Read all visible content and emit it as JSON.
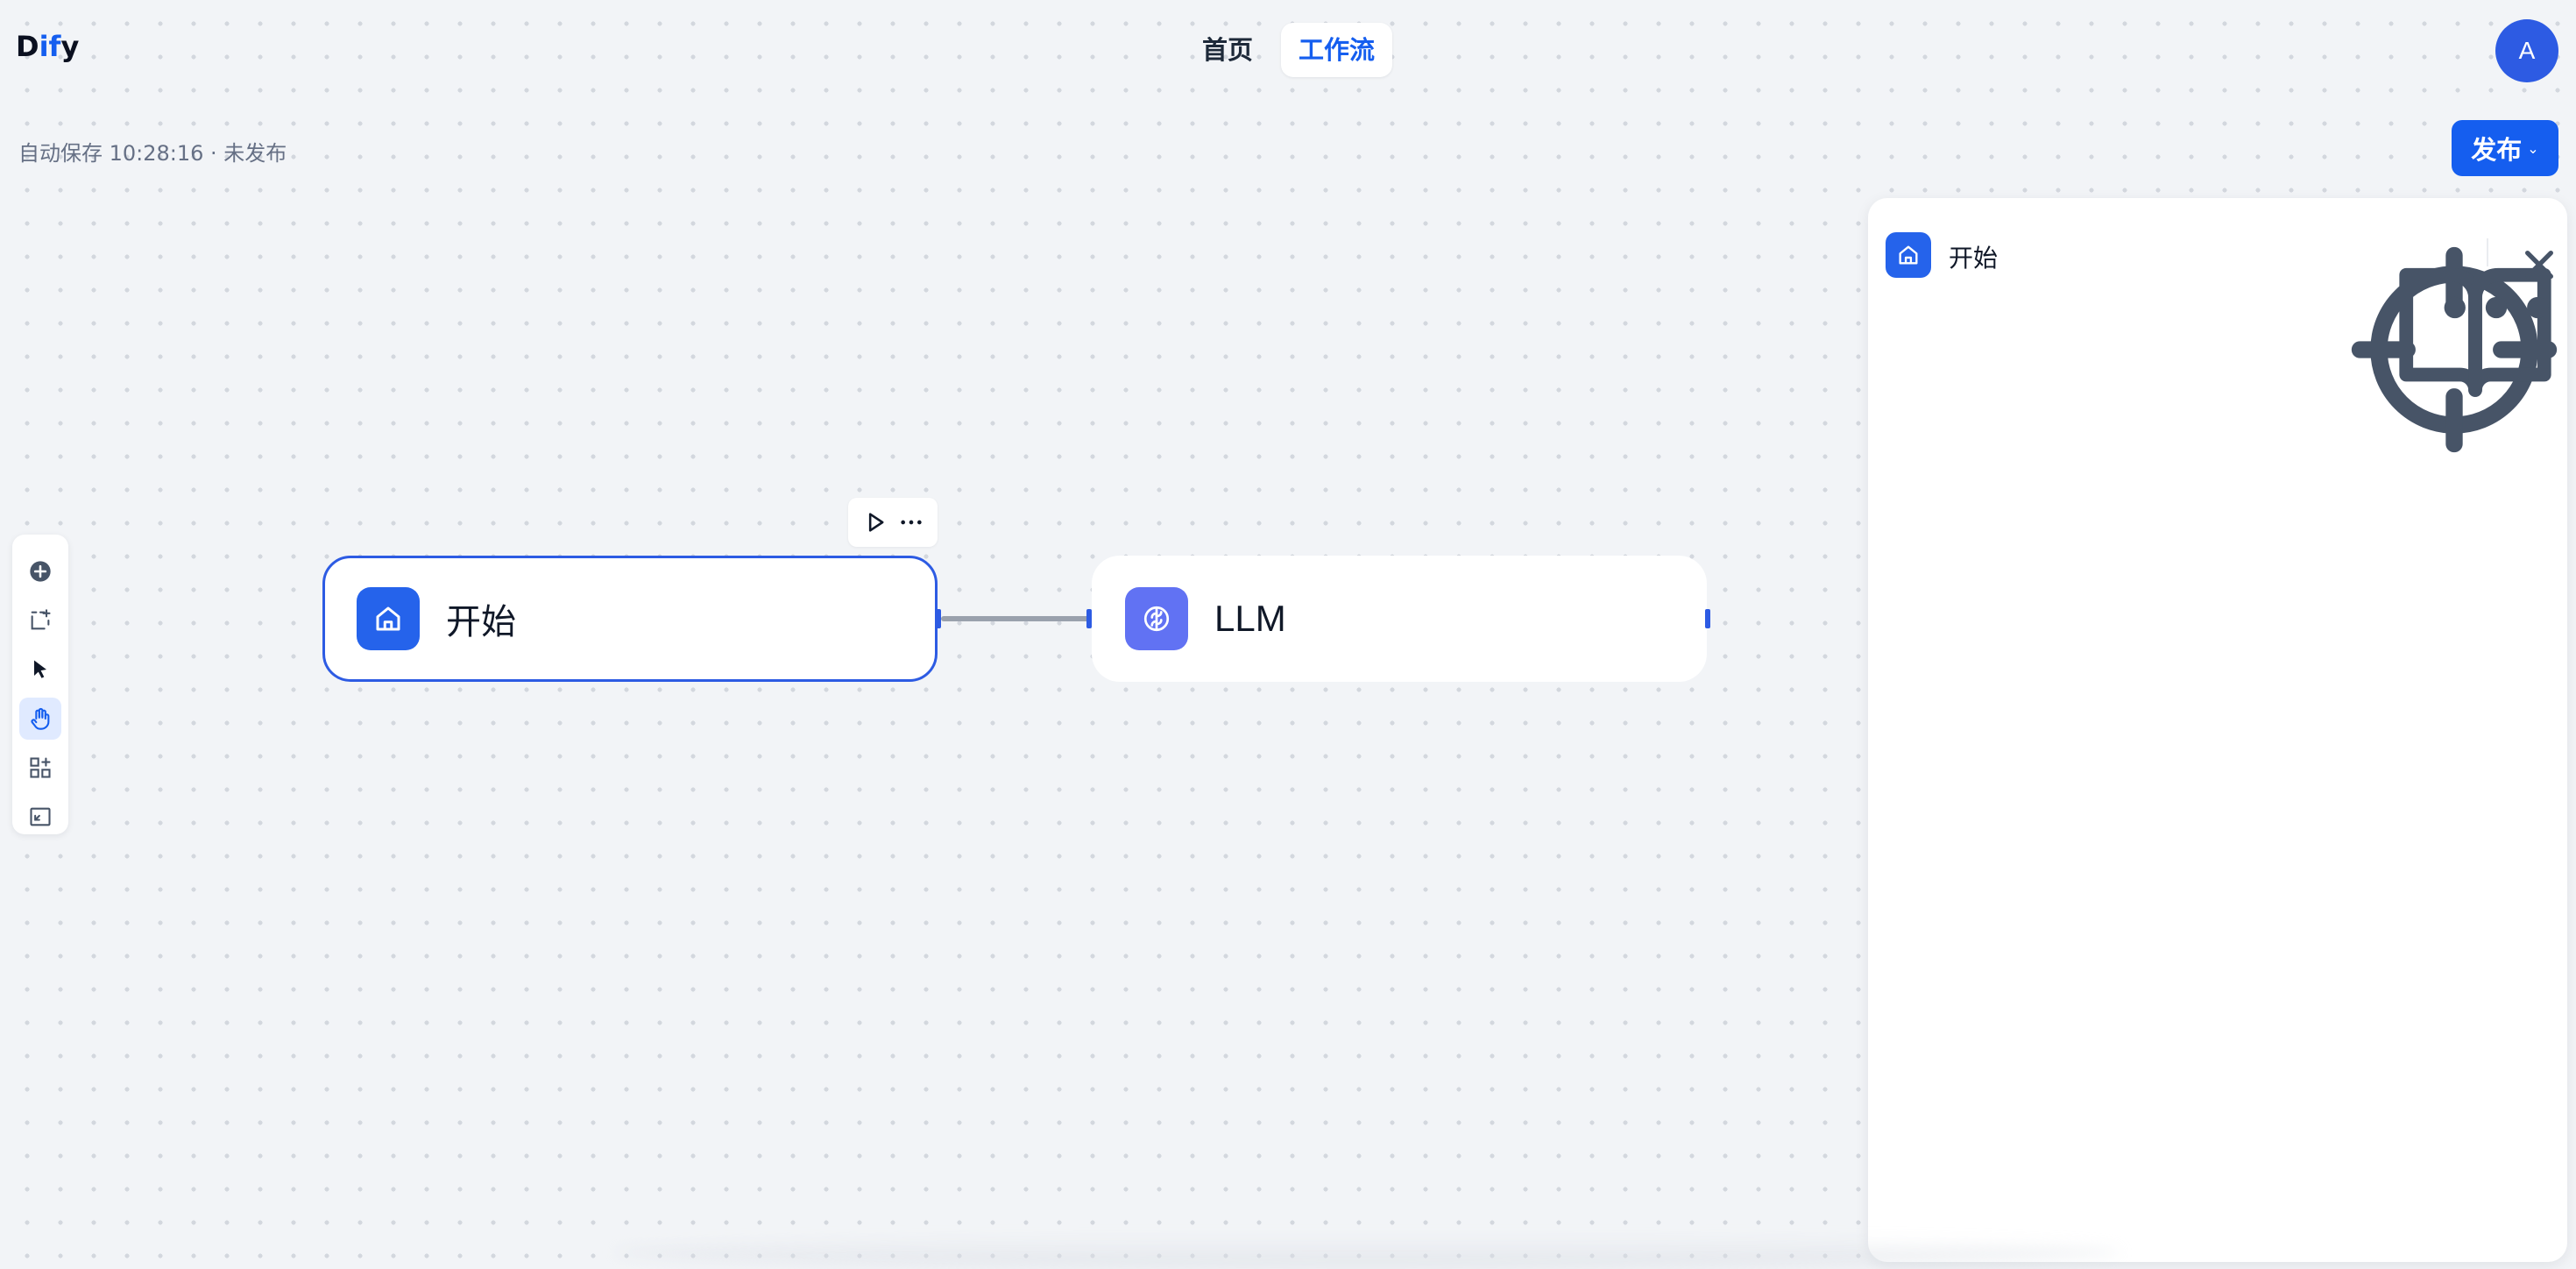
{
  "app": {
    "logo_prefix": "D",
    "logo_accent": "if",
    "logo_suffix": "y"
  },
  "nav": {
    "home_label": "首页",
    "workflow_label": "工作流"
  },
  "user": {
    "avatar_initial": "A"
  },
  "status": {
    "autosave_text": "自动保存 10:28:16 · 未发布"
  },
  "publish": {
    "label": "发布"
  },
  "toolbar": {
    "tools": [
      "add-node-icon",
      "add-note-icon",
      "pointer-icon",
      "hand-icon",
      "organize-blocks-icon",
      "fit-view-icon"
    ],
    "active_tool": "hand-icon"
  },
  "nodes": {
    "start": {
      "title": "开始",
      "icon": "home-icon"
    },
    "llm": {
      "title": "LLM",
      "icon": "brain-icon"
    }
  },
  "panel": {
    "title": "开始",
    "icon": "home-icon"
  },
  "colors": {
    "accent": "#155eef",
    "start_icon_bg": "#2563eb",
    "llm_icon_bg": "#6172f3",
    "canvas_bg": "#f2f4f7"
  }
}
